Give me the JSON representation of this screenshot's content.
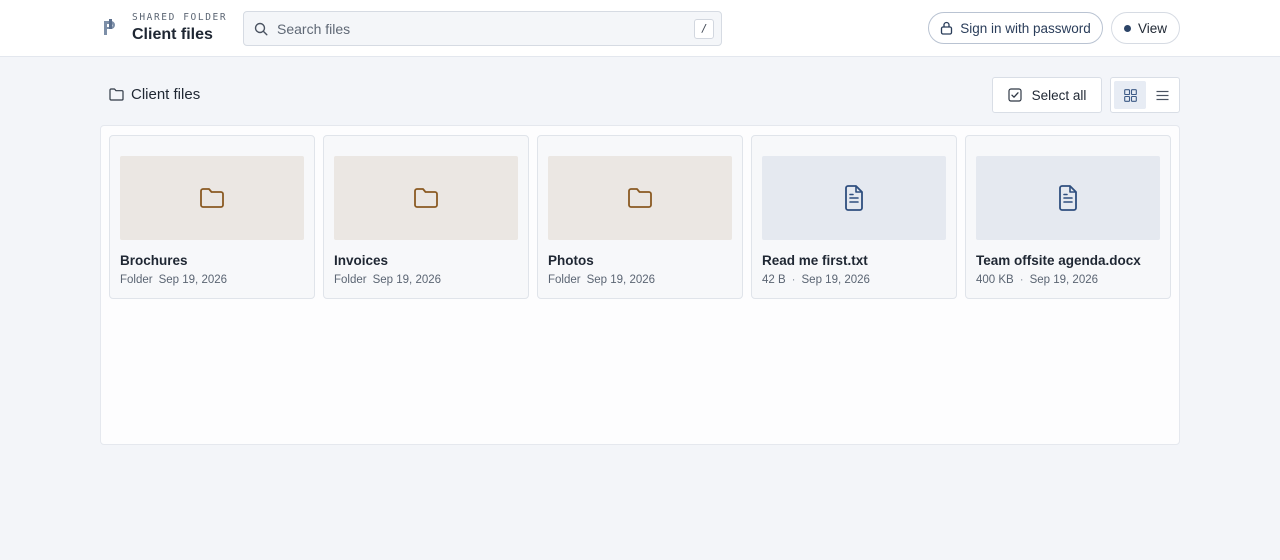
{
  "header": {
    "kicker": "SHARED FOLDER",
    "title": "Client files",
    "search_placeholder": "Search files",
    "search_shortcut": "/",
    "signin_label": "Sign in with password",
    "view_label": "View"
  },
  "breadcrumb": {
    "label": "Client files"
  },
  "toolbar": {
    "select_all_label": "Select all",
    "active_view": "grid"
  },
  "files": [
    {
      "name": "Brochures",
      "kind": "folder",
      "meta1": "Folder",
      "meta2": "Sep 19, 2026",
      "icon": "folder-icon"
    },
    {
      "name": "Invoices",
      "kind": "folder",
      "meta1": "Folder",
      "meta2": "Sep 19, 2026",
      "icon": "folder-icon"
    },
    {
      "name": "Photos",
      "kind": "folder",
      "meta1": "Folder",
      "meta2": "Sep 19, 2026",
      "icon": "folder-icon"
    },
    {
      "name": "Read me first.txt",
      "kind": "file",
      "meta1": "42 B",
      "meta2": "Sep 19, 2026",
      "icon": "document-icon"
    },
    {
      "name": "Team offsite agenda.docx",
      "kind": "file",
      "meta1": "400 KB",
      "meta2": "Sep 19, 2026",
      "icon": "document-icon"
    }
  ],
  "colors": {
    "folder_icon": "#8a5a22",
    "document_icon": "#2f4f7f",
    "accent": "#2c4467"
  }
}
